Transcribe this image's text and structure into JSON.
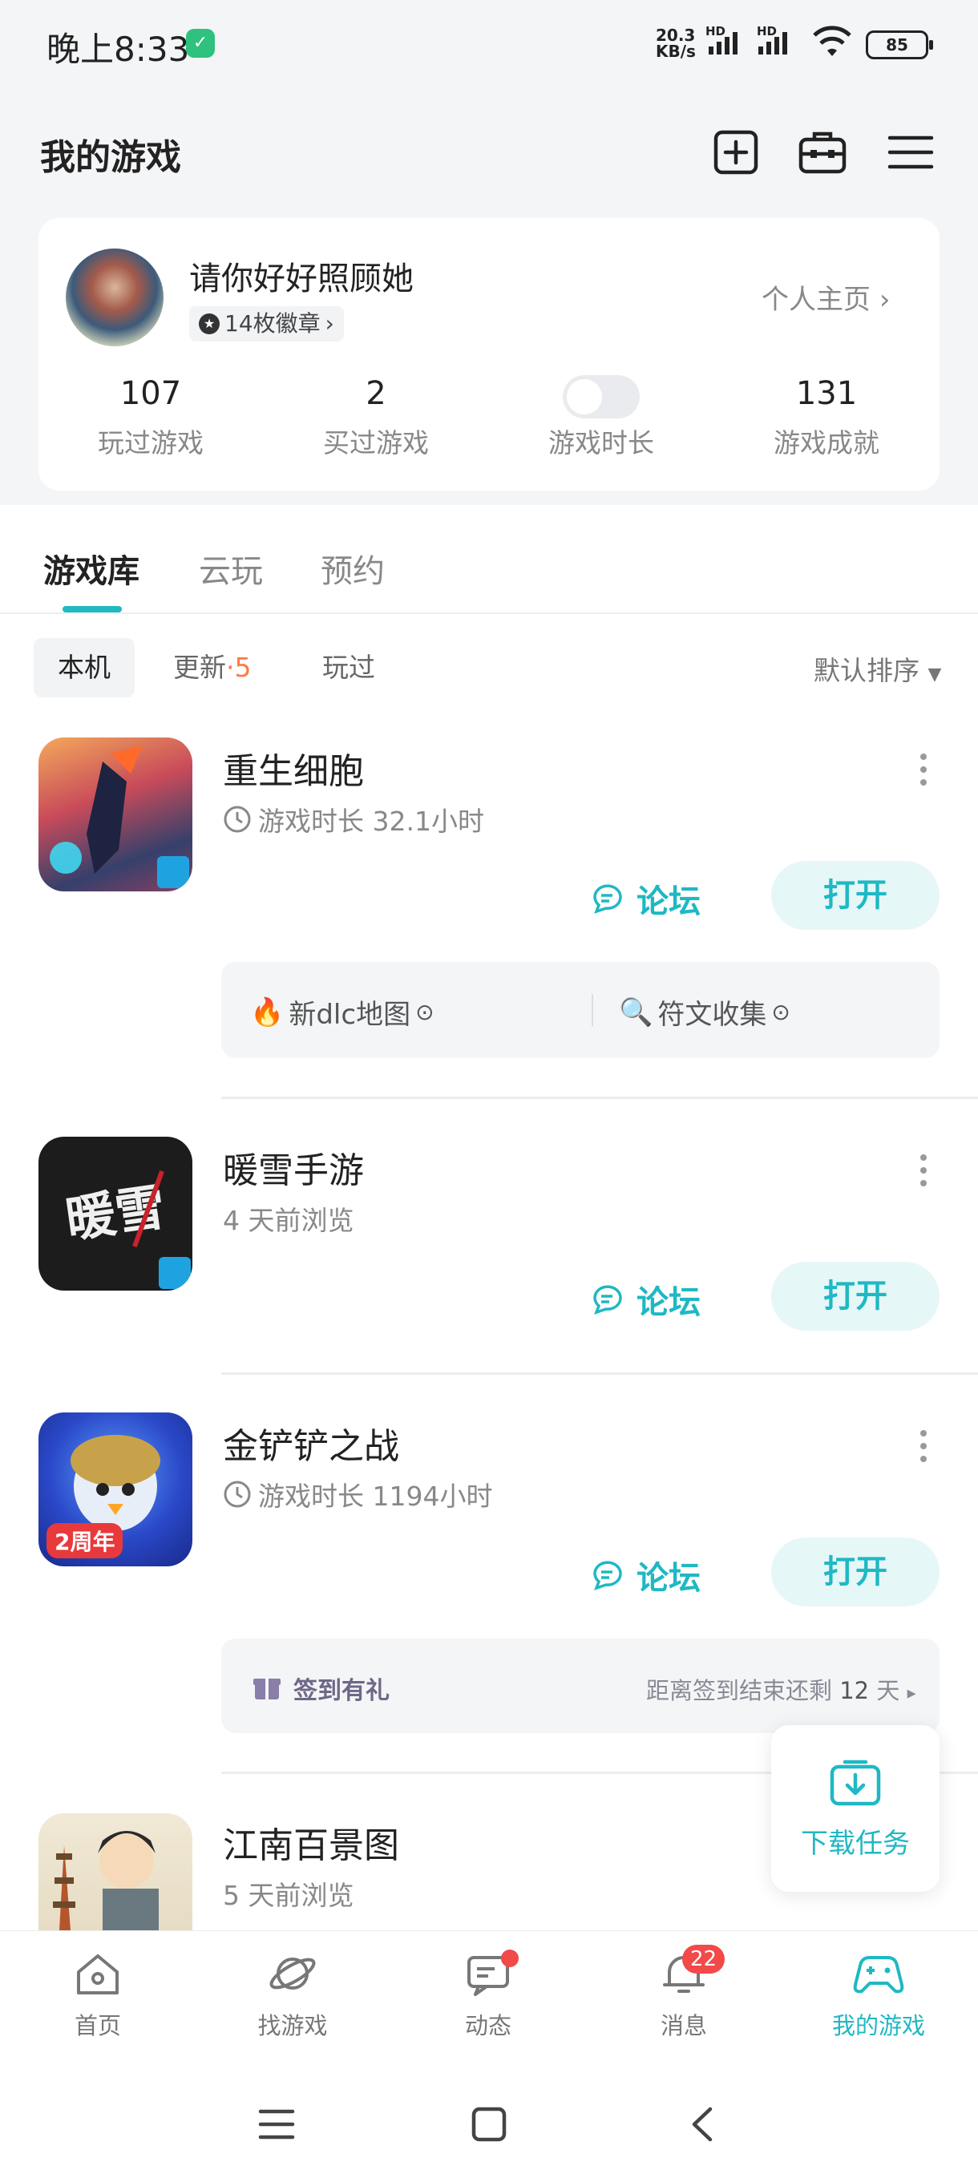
{
  "status_bar": {
    "time": "晚上8:33",
    "net_speed_value": "20.3",
    "net_speed_unit": "KB/s",
    "signal_tag_1": "HD",
    "signal_tag_2": "HD",
    "battery": "85"
  },
  "header": {
    "title": "我的游戏",
    "icons": [
      "add-square-icon",
      "toolbox-icon",
      "menu-icon"
    ]
  },
  "profile": {
    "username": "请你好好照顾她",
    "badges": "14枚徽章",
    "homepage_link": "个人主页",
    "stats": [
      {
        "num": "107",
        "label": "玩过游戏"
      },
      {
        "num": "2",
        "label": "买过游戏"
      },
      {
        "label": "游戏时长",
        "toggle_on": false
      },
      {
        "num": "131",
        "label": "游戏成就"
      }
    ]
  },
  "tabs": [
    {
      "label": "游戏库",
      "active": true
    },
    {
      "label": "云玩",
      "active": false
    },
    {
      "label": "预约",
      "active": false
    }
  ],
  "filters": {
    "local": "本机",
    "update": "更新",
    "update_sep": "·",
    "update_count": "5",
    "played": "玩过",
    "sort": "默认排序"
  },
  "games": [
    {
      "title": "重生细胞",
      "subtitle": "游戏时长 32.1小时",
      "forum": "论坛",
      "open": "打开",
      "tips": [
        {
          "emoji": "🔥",
          "text": "新dlc地图"
        },
        {
          "emoji": "🔍",
          "text": "符文收集"
        }
      ]
    },
    {
      "title": "暖雪手游",
      "subtitle": "4 天前浏览",
      "icon_text": "暖雪",
      "forum": "论坛",
      "open": "打开"
    },
    {
      "title": "金铲铲之战",
      "subtitle": "游戏时长 1194小时",
      "icon_text": "2周年",
      "forum": "论坛",
      "open": "打开",
      "signin_label": "签到有礼",
      "signin_remaining_prefix": "距离签到结束还剩",
      "signin_days": "12",
      "signin_unit": "天"
    },
    {
      "title": "江南百景图",
      "subtitle": "5 天前浏览"
    }
  ],
  "download_task": "下载任务",
  "bottom_nav": [
    {
      "label": "首页",
      "icon": "home-icon"
    },
    {
      "label": "找游戏",
      "icon": "planet-icon"
    },
    {
      "label": "动态",
      "icon": "chat-icon",
      "dot": true
    },
    {
      "label": "消息",
      "icon": "bell-icon",
      "badge": "22"
    },
    {
      "label": "我的游戏",
      "icon": "gamepad-icon",
      "active": true
    }
  ],
  "colors": {
    "accent": "#1fb8c3",
    "count_orange": "#ff7a45",
    "badge_red": "#f24949"
  }
}
